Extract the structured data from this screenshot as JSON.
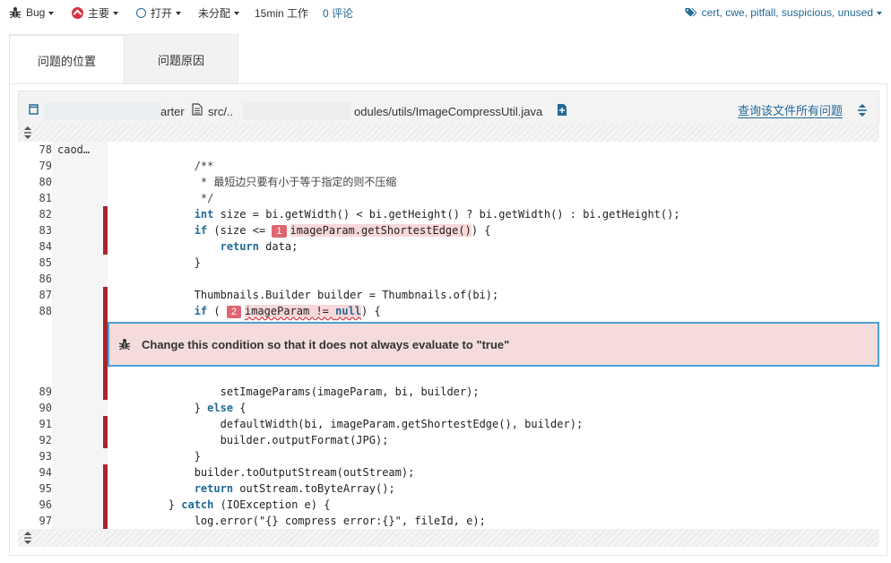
{
  "top_bar": {
    "type_label": "Bug",
    "severity_label": "主要",
    "status_label": "打开",
    "assignee_label": "未分配",
    "effort_label": "15min 工作",
    "comments_label": "0 评论",
    "tags_label": "cert, cwe, pitfall, suspicious, unused"
  },
  "tabs": [
    {
      "label": "问题的位置"
    },
    {
      "label": "问题原因"
    }
  ],
  "file_header": {
    "project_suffix": "arter",
    "path_prefix": "src/..",
    "path_suffix": "odules/utils/ImageCompressUtil.java",
    "all_issues_link": "查询该文件所有问题"
  },
  "code": {
    "blame_author": "caod…",
    "issue_message": "Change this condition so that it does not always evaluate to \"true\"",
    "lines": [
      {
        "n": "78",
        "text": ""
      },
      {
        "n": "79",
        "text": "            /**"
      },
      {
        "n": "80",
        "text": "             * 最短边只要有小于等于指定的则不压缩"
      },
      {
        "n": "81",
        "text": "             */"
      },
      {
        "n": "82",
        "text": "            int size = bi.getWidth() < bi.getHeight() ? bi.getWidth() : bi.getHeight();"
      },
      {
        "n": "83",
        "text": "            if (size <= 1 imageParam.getShortestEdge()) {"
      },
      {
        "n": "84",
        "text": "                return data;"
      },
      {
        "n": "85",
        "text": "            }"
      },
      {
        "n": "86",
        "text": ""
      },
      {
        "n": "87",
        "text": "            Thumbnails.Builder builder = Thumbnails.of(bi);"
      },
      {
        "n": "88",
        "text": "            if ( 2 imageParam != null) {"
      },
      {
        "n": "89",
        "text": "                setImageParams(imageParam, bi, builder);"
      },
      {
        "n": "90",
        "text": "            } else {"
      },
      {
        "n": "91",
        "text": "                defaultWidth(bi, imageParam.getShortestEdge(), builder);"
      },
      {
        "n": "92",
        "text": "                builder.outputFormat(JPG);"
      },
      {
        "n": "93",
        "text": "            }"
      },
      {
        "n": "94",
        "text": "            builder.toOutputStream(outStream);"
      },
      {
        "n": "95",
        "text": "            return outStream.toByteArray();"
      },
      {
        "n": "96",
        "text": "        } catch (IOException e) {"
      },
      {
        "n": "97",
        "text": "            log.error(\"{} compress error:{}\", fileId, e);"
      }
    ]
  },
  "colors": {
    "link": "#236a97",
    "issue_mark": "#a9242d",
    "issue_bg": "#f4dcdd",
    "issue_border": "#4b9fd5"
  }
}
